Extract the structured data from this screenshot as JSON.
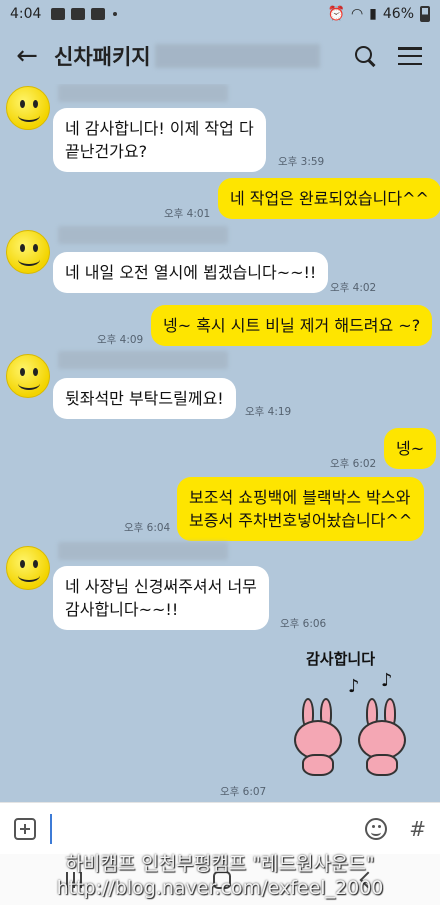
{
  "status_bar": {
    "time": "4:04",
    "battery": "46%"
  },
  "header": {
    "title": "신차패키지"
  },
  "messages": [
    {
      "dir": "in",
      "lines": [
        "네 감사합니다! 이제 작업 다",
        "끝난건가요?"
      ],
      "time": "오후 3:59"
    },
    {
      "dir": "out",
      "lines": [
        "네 작업은 완료되었습니다^^"
      ],
      "time": "오후 4:01"
    },
    {
      "dir": "in",
      "lines": [
        "네 내일 오전 열시에 뵙겠습니다~~!!"
      ],
      "time": "오후 4:02"
    },
    {
      "dir": "out",
      "lines": [
        "넹~ 혹시 시트 비닐 제거 해드려요 ~?"
      ],
      "time": "오후 4:09"
    },
    {
      "dir": "in",
      "lines": [
        "뒷좌석만 부탁드릴께요!"
      ],
      "time": "오후 4:19"
    },
    {
      "dir": "out",
      "lines": [
        "넹~"
      ],
      "time": "오후 6:02"
    },
    {
      "dir": "out",
      "lines": [
        "보조석 쇼핑백에 블랙박스 박스와",
        "보증서 주차번호넣어놨습니다^^"
      ],
      "time": "오후 6:04"
    },
    {
      "dir": "in",
      "lines": [
        "네 사장님 신경써주셔서 너무",
        "감사합니다~~!!"
      ],
      "time": "오후 6:06"
    }
  ],
  "sticker": {
    "text": "감사합니다",
    "time": "오후 6:07"
  },
  "input": {
    "placeholder": ""
  },
  "icons": {
    "hash": "#",
    "note": "♪"
  },
  "watermark": {
    "line1": "하비캠프 인천부평캠프 \"레드원사운드\"",
    "line2": "http://blog.naver.com/exfeel_2000"
  },
  "colors": {
    "chat_bg": "#b2c7da",
    "out_bubble": "#fee500",
    "in_bubble": "#ffffff"
  }
}
